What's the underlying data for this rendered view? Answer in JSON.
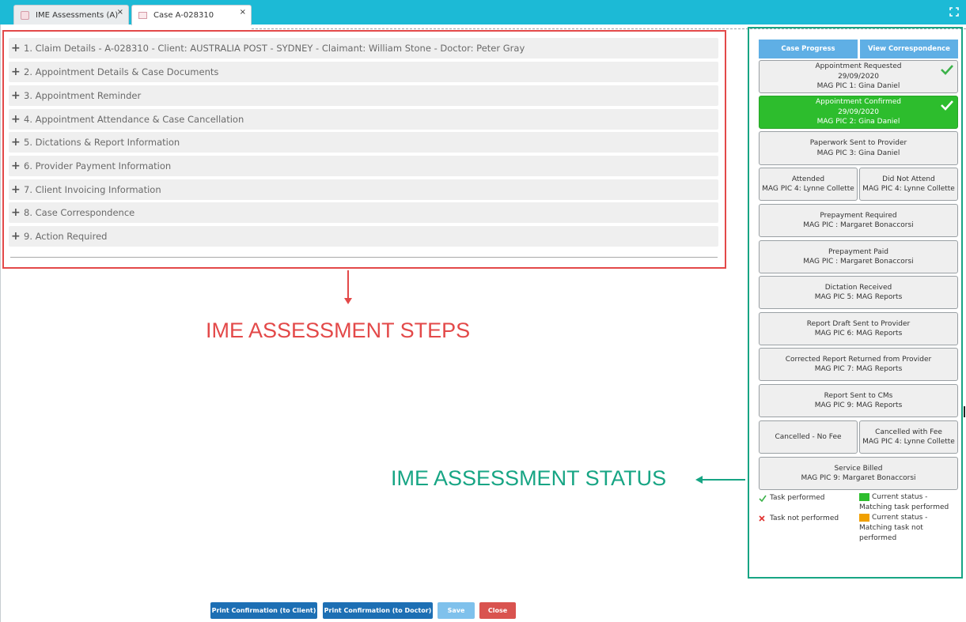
{
  "tabs": [
    {
      "label": "IME Assessments (A)",
      "close": "×"
    },
    {
      "label": "Case A-028310",
      "close": "×"
    }
  ],
  "steps": [
    "1. Claim Details - A-028310 - Client: AUSTRALIA POST - SYDNEY - Claimant: William Stone - Doctor: Peter Gray",
    "2. Appointment Details & Case Documents",
    "3. Appointment Reminder",
    "4. Appointment Attendance & Case Cancellation",
    "5. Dictations & Report Information",
    "6. Provider Payment Information",
    "7. Client Invoicing Information",
    "8. Case Correspondence",
    "9. Action Required"
  ],
  "annotations": {
    "steps_caption": "IME ASSESSMENT STEPS",
    "status_caption": "IME ASSESSMENT STATUS"
  },
  "status_panel": {
    "case_progress": "Case Progress",
    "view_correspondence": "View Correspondence",
    "items": [
      {
        "title": "Appointment Requested",
        "date": "29/09/2020",
        "pic": "MAG PIC 1: Gina Daniel",
        "state": "performed"
      },
      {
        "title": "Appointment Confirmed",
        "date": "29/09/2020",
        "pic": "MAG PIC 2: Gina Daniel",
        "state": "current-performed"
      },
      {
        "title": "Paperwork Sent to Provider",
        "pic": "MAG PIC 3: Gina Daniel"
      },
      {
        "title": "Attended",
        "pic": "MAG PIC 4: Lynne Collette"
      },
      {
        "title": "Did Not Attend",
        "pic": "MAG PIC 4: Lynne Collette"
      },
      {
        "title": "Prepayment Required",
        "pic": "MAG PIC : Margaret Bonaccorsi"
      },
      {
        "title": "Prepayment Paid",
        "pic": "MAG PIC : Margaret Bonaccorsi"
      },
      {
        "title": "Dictation Received",
        "pic": "MAG PIC 5: MAG Reports"
      },
      {
        "title": "Report Draft Sent to Provider",
        "pic": "MAG PIC 6: MAG Reports"
      },
      {
        "title": "Corrected Report Returned from Provider",
        "pic": "MAG PIC 7: MAG Reports"
      },
      {
        "title": "Report Sent to CMs",
        "pic": "MAG PIC 9: MAG Reports"
      },
      {
        "title": "Cancelled - No Fee",
        "pic": ""
      },
      {
        "title": "Cancelled with Fee",
        "pic": "MAG PIC 4: Lynne Collette"
      },
      {
        "title": "Service Billed",
        "pic": "MAG PIC 9: Margaret Bonaccorsi"
      }
    ],
    "legend": {
      "performed": "Task performed",
      "not_performed": "Task not performed",
      "current_green_1": "Current status -",
      "current_green_2": "Matching task performed",
      "current_orange_1": "Current status -",
      "current_orange_2": "Matching task not",
      "current_orange_3": "performed"
    }
  },
  "footer": {
    "print_client": "Print Confirmation (to Client)",
    "print_doctor": "Print Confirmation (to Doctor)",
    "save": "Save",
    "close": "Close"
  },
  "colors": {
    "tabbar": "#1cbad6",
    "steps_annotation": "#e34949",
    "status_annotation": "#17a584",
    "current_performed": "#2dbd2d",
    "current_not_performed": "#f0a000",
    "primary_button": "#1d6fb4",
    "close_button": "#d9534f"
  },
  "icons": [
    "plus-icon",
    "check-icon",
    "cross-icon",
    "expand-icon",
    "document-icon",
    "folder-icon"
  ]
}
